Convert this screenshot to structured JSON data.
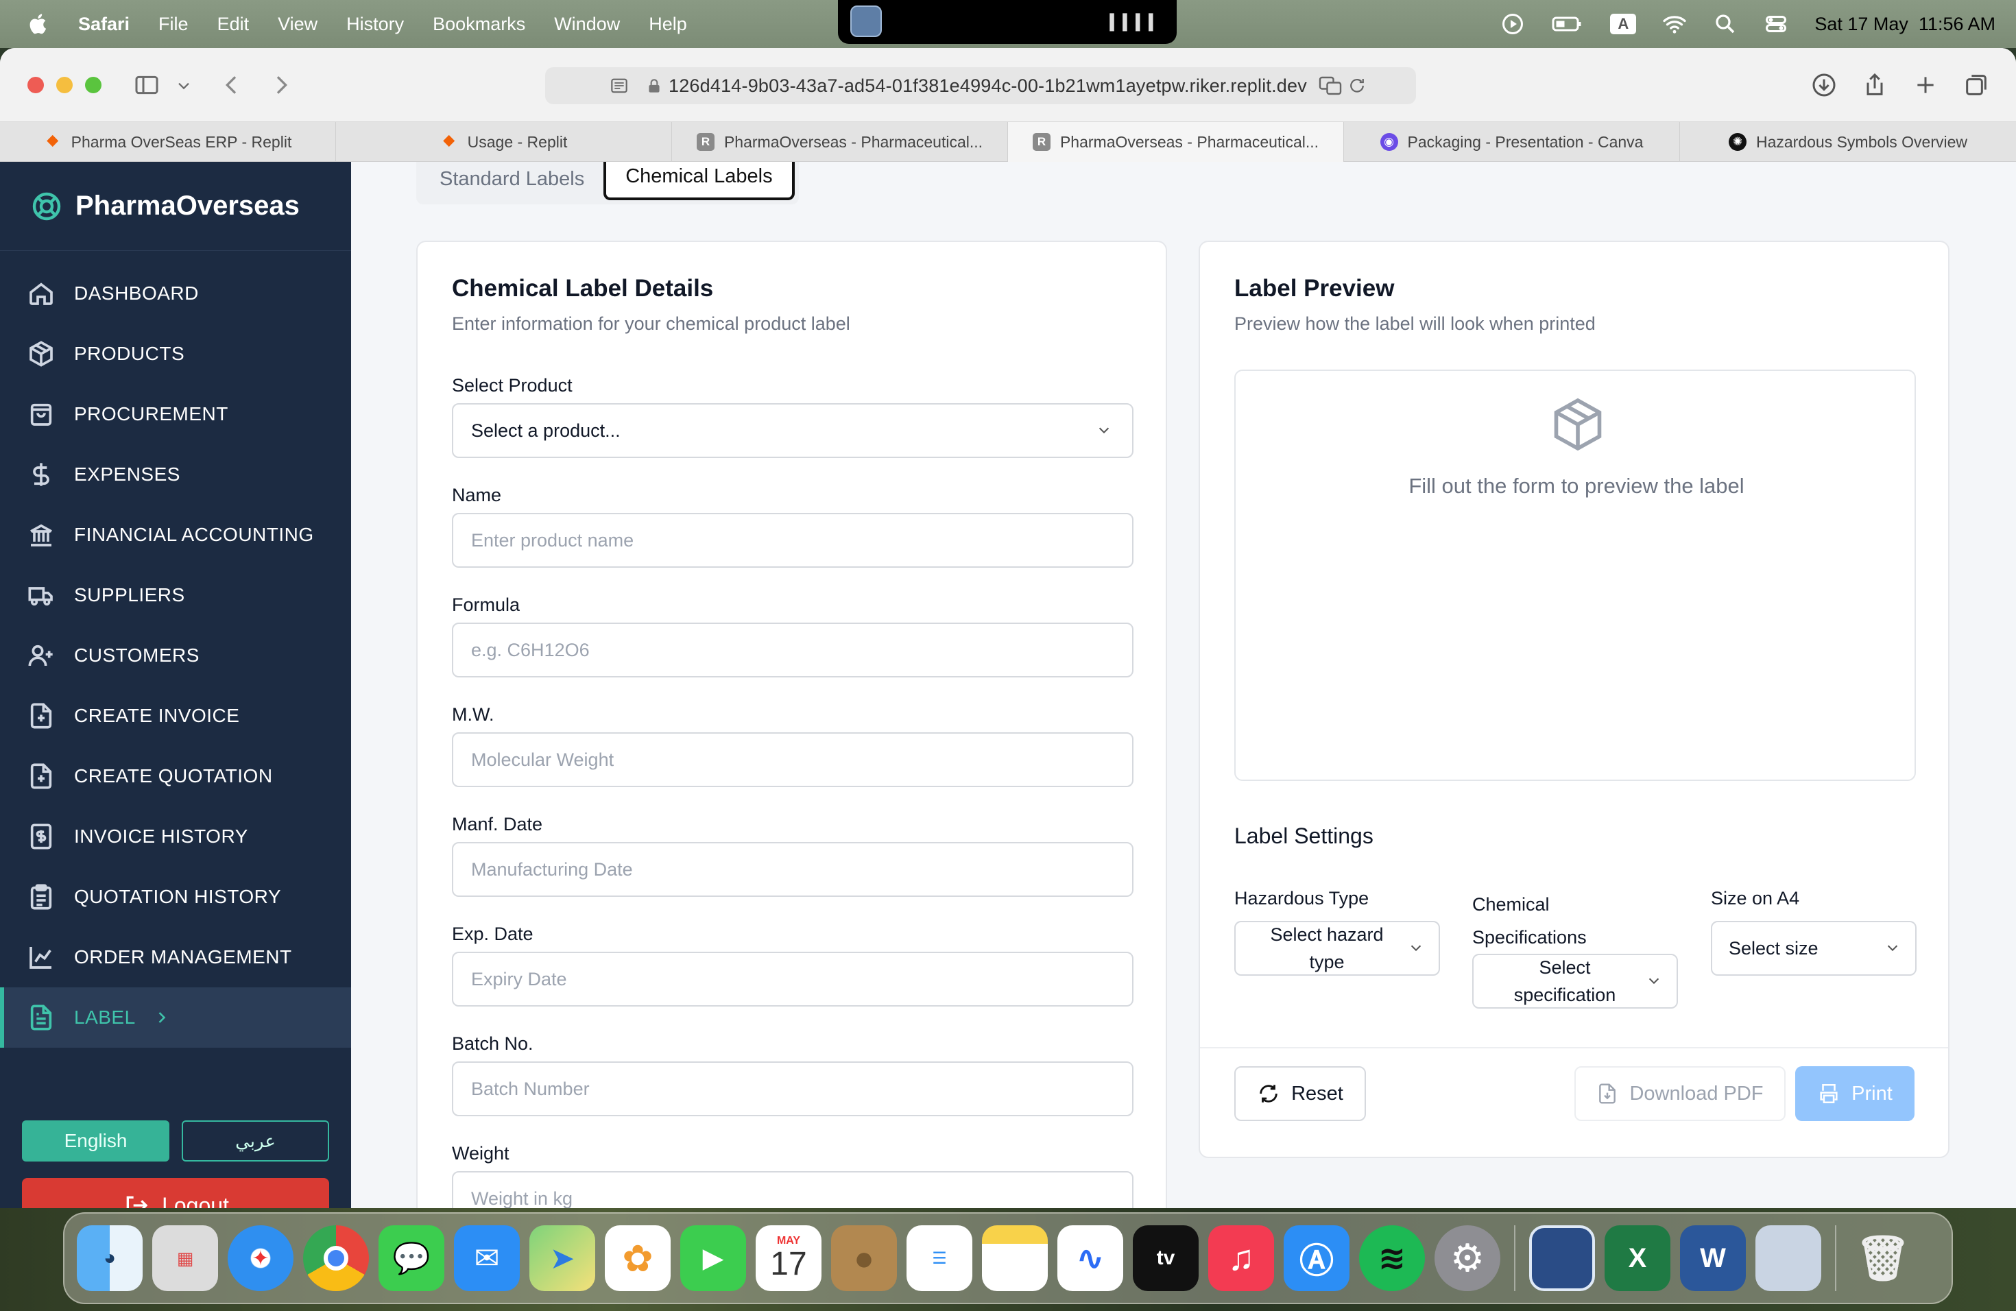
{
  "menubar": {
    "app": "Safari",
    "items": [
      "File",
      "Edit",
      "View",
      "History",
      "Bookmarks",
      "Window",
      "Help"
    ],
    "input_source": "A",
    "datetime": "Sat 17 May  11:56 AM"
  },
  "browser": {
    "url": "126d414-9b03-43a7-ad54-01f381e4994c-00-1b21wm1ayetpw.riker.replit.dev",
    "tabs": [
      {
        "label": "Pharma OverSeas ERP - Replit",
        "fav": "replit"
      },
      {
        "label": "Usage - Replit",
        "fav": "replit"
      },
      {
        "label": "PharmaOverseas - Pharmaceutical...",
        "fav": "R"
      },
      {
        "label": "PharmaOverseas - Pharmaceutical...",
        "fav": "R"
      },
      {
        "label": "Packaging - Presentation - Canva",
        "fav": "canva"
      },
      {
        "label": "Hazardous Symbols Overview",
        "fav": "openai"
      }
    ]
  },
  "sidebar": {
    "brand": "PharmaOverseas",
    "items": [
      {
        "label": "DASHBOARD",
        "icon": "home-icon"
      },
      {
        "label": "PRODUCTS",
        "icon": "box-icon"
      },
      {
        "label": "PROCUREMENT",
        "icon": "shopping-bag-icon"
      },
      {
        "label": "EXPENSES",
        "icon": "dollar-icon"
      },
      {
        "label": "FINANCIAL ACCOUNTING",
        "icon": "bank-icon"
      },
      {
        "label": "SUPPLIERS",
        "icon": "truck-icon"
      },
      {
        "label": "CUSTOMERS",
        "icon": "user-plus-icon"
      },
      {
        "label": "CREATE INVOICE",
        "icon": "file-plus-icon"
      },
      {
        "label": "CREATE QUOTATION",
        "icon": "file-plus-icon"
      },
      {
        "label": "INVOICE HISTORY",
        "icon": "receipt-icon"
      },
      {
        "label": "QUOTATION HISTORY",
        "icon": "clipboard-icon"
      },
      {
        "label": "ORDER MANAGEMENT",
        "icon": "chart-icon"
      },
      {
        "label": "LABEL",
        "icon": "file-text-icon"
      }
    ],
    "lang_en": "English",
    "lang_ar": "عربي",
    "logout": "Logout"
  },
  "label_tabs": {
    "standard": "Standard Labels",
    "chemical": "Chemical Labels"
  },
  "details": {
    "title": "Chemical Label Details",
    "subtitle": "Enter information for your chemical product label",
    "select_product_label": "Select Product",
    "select_product_value": "Select a product...",
    "fields": [
      {
        "label": "Name",
        "placeholder": "Enter product name"
      },
      {
        "label": "Formula",
        "placeholder": "e.g. C6H12O6"
      },
      {
        "label": "M.W.",
        "placeholder": "Molecular Weight"
      },
      {
        "label": "Manf. Date",
        "placeholder": "Manufacturing Date"
      },
      {
        "label": "Exp. Date",
        "placeholder": "Expiry Date"
      },
      {
        "label": "Batch No.",
        "placeholder": "Batch Number"
      },
      {
        "label": "Weight",
        "placeholder": "Weight in kg"
      }
    ]
  },
  "preview": {
    "title": "Label Preview",
    "subtitle": "Preview how the label will look when printed",
    "empty_message": "Fill out the form to preview the label",
    "settings_title": "Label Settings",
    "hazard_label": "Hazardous Type",
    "hazard_value_1": "Select hazard",
    "hazard_value_2": "type",
    "spec_label_1": "Chemical",
    "spec_label_2": "Specifications",
    "spec_value_1": "Select",
    "spec_value_2": "specification",
    "size_label": "Size on A4",
    "size_value": "Select size",
    "reset": "Reset",
    "download": "Download PDF",
    "print": "Print"
  },
  "dock": {
    "calendar_month": "MAY",
    "calendar_day": "17",
    "tv": "tv"
  }
}
